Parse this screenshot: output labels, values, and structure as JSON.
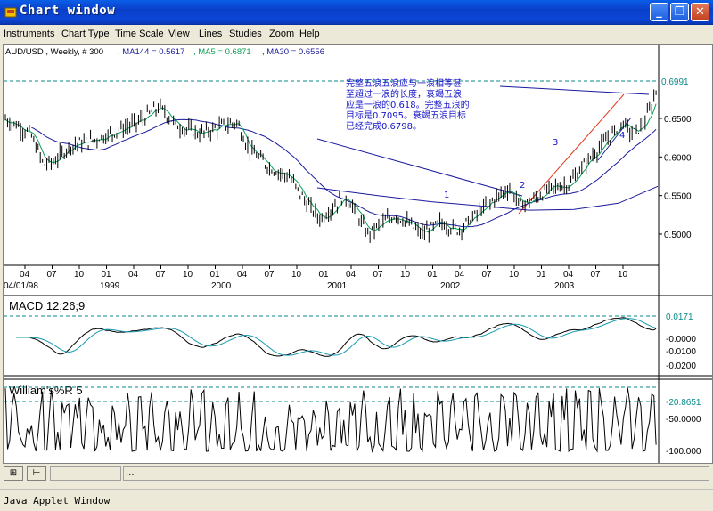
{
  "window": {
    "title": "Chart window",
    "status": "Java Applet Window"
  },
  "menu": [
    "Instruments",
    "Chart Type",
    "Time Scale",
    "View",
    "Lines",
    "Studies",
    "Zoom",
    "Help"
  ],
  "titlebar_buttons": {
    "minimize": "_",
    "maximize": "❐",
    "close": "✕"
  },
  "chart_header": {
    "symbol": "AUD/USD , Weekly, # 300",
    "ma144": ", MA144 = 0.5617",
    "ma5": ", MA5 = 0.6871",
    "ma30": ", MA30 = 0.6556"
  },
  "annotation_lines": [
    "完整五浪五浪应与一浪相等甚",
    "至超过一浪的长度，衰竭五浪",
    "应是一浪的0.618。完整五浪的",
    "目标是0.7095。衰竭五浪目标",
    "已经完成0.6798。"
  ],
  "wave_labels": [
    "1",
    "2",
    "3",
    "4"
  ],
  "colors": {
    "price": "#000000",
    "ma5": "#0b9d55",
    "ma30": "#1a1a9e",
    "ma144": "#1a1a9e",
    "trend_red": "#e03a1e",
    "dashed": "#0a8a8a",
    "macd_signal": "#1a9ab0",
    "annotation": "#1414c8"
  },
  "price_panel": {
    "y_ticks": [
      "0.6500",
      "0.6000",
      "0.5500",
      "0.5000"
    ],
    "last_value": "0.6991",
    "month_ticks": [
      "04",
      "07",
      "10",
      "01",
      "04",
      "07",
      "10",
      "01",
      "04",
      "07",
      "10",
      "01",
      "04",
      "07",
      "10",
      "01",
      "04",
      "07",
      "10",
      "01",
      "04",
      "07",
      "10"
    ],
    "year_labels": [
      "04/01/98",
      "1999",
      "2000",
      "2001",
      "2002",
      "2003"
    ]
  },
  "macd_panel": {
    "label": "MACD 12;26;9",
    "y_ticks": [
      "-0.0000",
      "-0.0100",
      "-0.0200"
    ],
    "last_value": "0.0171"
  },
  "williams_panel": {
    "label": "William's%R 5",
    "y_ticks": [
      "-50.0000",
      "-100.000"
    ],
    "last_value": "-20.8651"
  },
  "bottom_controls": {
    "zoom_btn": "⊞",
    "split_btn": "⊢",
    "field_text": "..."
  }
}
